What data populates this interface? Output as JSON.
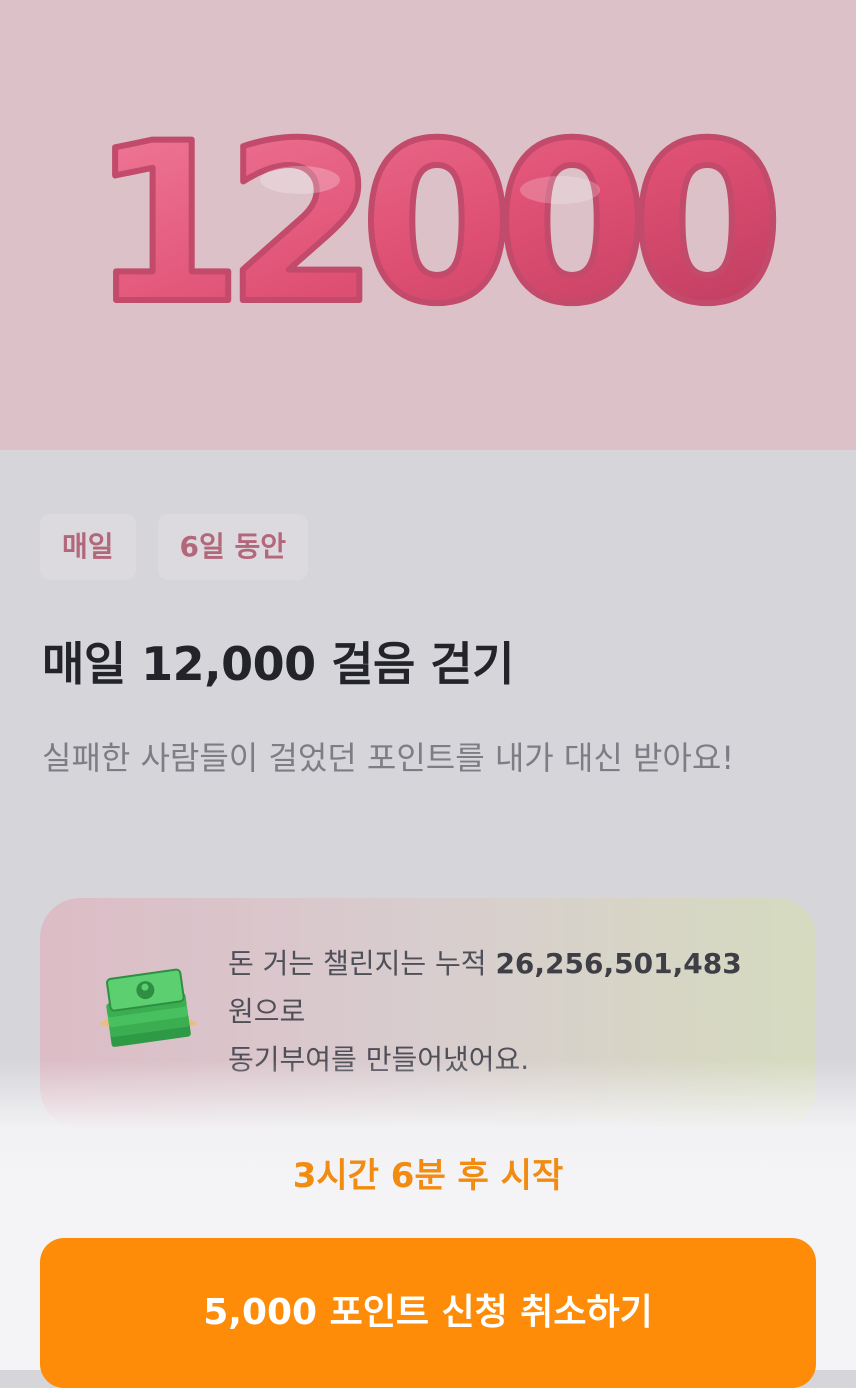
{
  "hero": {
    "number_text": "12000",
    "background_color": "#dcc1c8",
    "balloon_color": "#e85d82"
  },
  "tags": [
    "매일",
    "6일 동안"
  ],
  "challenge": {
    "title": "매일 12,000 걸음 걷기",
    "description": "실패한 사람들이 걸었던 포인트를 내가 대신 받아요!"
  },
  "stats_card": {
    "icon": "money-stack-icon",
    "text_before": "돈 거는 챌린지는 누적 ",
    "amount": "26,256,501,483",
    "text_after": "원으로",
    "line2": "동기부여를 만들어냈어요."
  },
  "start_countdown": "3시간 6분 후 시작",
  "cta": {
    "label": "5,000 포인트 신청 취소하기",
    "color": "#fe8c08"
  }
}
